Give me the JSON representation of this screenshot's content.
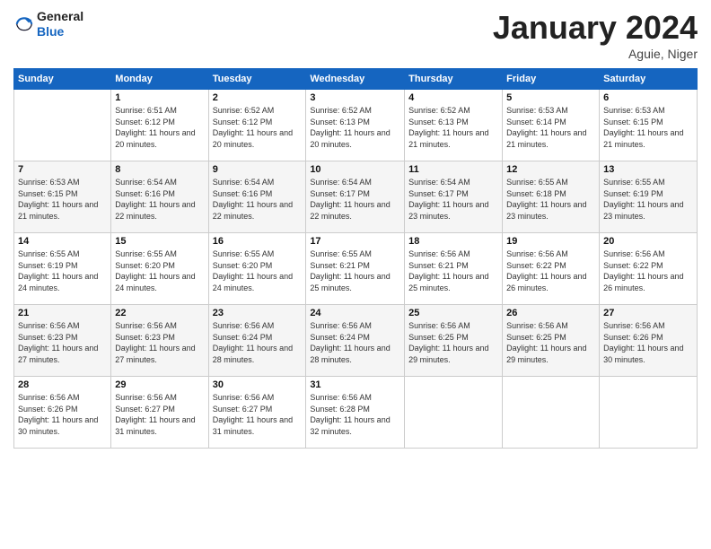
{
  "logo": {
    "line1": "General",
    "line2": "Blue"
  },
  "title": "January 2024",
  "location": "Aguie, Niger",
  "header_days": [
    "Sunday",
    "Monday",
    "Tuesday",
    "Wednesday",
    "Thursday",
    "Friday",
    "Saturday"
  ],
  "weeks": [
    [
      {
        "day": "",
        "sunrise": "",
        "sunset": "",
        "daylight": ""
      },
      {
        "day": "1",
        "sunrise": "Sunrise: 6:51 AM",
        "sunset": "Sunset: 6:12 PM",
        "daylight": "Daylight: 11 hours and 20 minutes."
      },
      {
        "day": "2",
        "sunrise": "Sunrise: 6:52 AM",
        "sunset": "Sunset: 6:12 PM",
        "daylight": "Daylight: 11 hours and 20 minutes."
      },
      {
        "day": "3",
        "sunrise": "Sunrise: 6:52 AM",
        "sunset": "Sunset: 6:13 PM",
        "daylight": "Daylight: 11 hours and 20 minutes."
      },
      {
        "day": "4",
        "sunrise": "Sunrise: 6:52 AM",
        "sunset": "Sunset: 6:13 PM",
        "daylight": "Daylight: 11 hours and 21 minutes."
      },
      {
        "day": "5",
        "sunrise": "Sunrise: 6:53 AM",
        "sunset": "Sunset: 6:14 PM",
        "daylight": "Daylight: 11 hours and 21 minutes."
      },
      {
        "day": "6",
        "sunrise": "Sunrise: 6:53 AM",
        "sunset": "Sunset: 6:15 PM",
        "daylight": "Daylight: 11 hours and 21 minutes."
      }
    ],
    [
      {
        "day": "7",
        "sunrise": "Sunrise: 6:53 AM",
        "sunset": "Sunset: 6:15 PM",
        "daylight": "Daylight: 11 hours and 21 minutes."
      },
      {
        "day": "8",
        "sunrise": "Sunrise: 6:54 AM",
        "sunset": "Sunset: 6:16 PM",
        "daylight": "Daylight: 11 hours and 22 minutes."
      },
      {
        "day": "9",
        "sunrise": "Sunrise: 6:54 AM",
        "sunset": "Sunset: 6:16 PM",
        "daylight": "Daylight: 11 hours and 22 minutes."
      },
      {
        "day": "10",
        "sunrise": "Sunrise: 6:54 AM",
        "sunset": "Sunset: 6:17 PM",
        "daylight": "Daylight: 11 hours and 22 minutes."
      },
      {
        "day": "11",
        "sunrise": "Sunrise: 6:54 AM",
        "sunset": "Sunset: 6:17 PM",
        "daylight": "Daylight: 11 hours and 23 minutes."
      },
      {
        "day": "12",
        "sunrise": "Sunrise: 6:55 AM",
        "sunset": "Sunset: 6:18 PM",
        "daylight": "Daylight: 11 hours and 23 minutes."
      },
      {
        "day": "13",
        "sunrise": "Sunrise: 6:55 AM",
        "sunset": "Sunset: 6:19 PM",
        "daylight": "Daylight: 11 hours and 23 minutes."
      }
    ],
    [
      {
        "day": "14",
        "sunrise": "Sunrise: 6:55 AM",
        "sunset": "Sunset: 6:19 PM",
        "daylight": "Daylight: 11 hours and 24 minutes."
      },
      {
        "day": "15",
        "sunrise": "Sunrise: 6:55 AM",
        "sunset": "Sunset: 6:20 PM",
        "daylight": "Daylight: 11 hours and 24 minutes."
      },
      {
        "day": "16",
        "sunrise": "Sunrise: 6:55 AM",
        "sunset": "Sunset: 6:20 PM",
        "daylight": "Daylight: 11 hours and 24 minutes."
      },
      {
        "day": "17",
        "sunrise": "Sunrise: 6:55 AM",
        "sunset": "Sunset: 6:21 PM",
        "daylight": "Daylight: 11 hours and 25 minutes."
      },
      {
        "day": "18",
        "sunrise": "Sunrise: 6:56 AM",
        "sunset": "Sunset: 6:21 PM",
        "daylight": "Daylight: 11 hours and 25 minutes."
      },
      {
        "day": "19",
        "sunrise": "Sunrise: 6:56 AM",
        "sunset": "Sunset: 6:22 PM",
        "daylight": "Daylight: 11 hours and 26 minutes."
      },
      {
        "day": "20",
        "sunrise": "Sunrise: 6:56 AM",
        "sunset": "Sunset: 6:22 PM",
        "daylight": "Daylight: 11 hours and 26 minutes."
      }
    ],
    [
      {
        "day": "21",
        "sunrise": "Sunrise: 6:56 AM",
        "sunset": "Sunset: 6:23 PM",
        "daylight": "Daylight: 11 hours and 27 minutes."
      },
      {
        "day": "22",
        "sunrise": "Sunrise: 6:56 AM",
        "sunset": "Sunset: 6:23 PM",
        "daylight": "Daylight: 11 hours and 27 minutes."
      },
      {
        "day": "23",
        "sunrise": "Sunrise: 6:56 AM",
        "sunset": "Sunset: 6:24 PM",
        "daylight": "Daylight: 11 hours and 28 minutes."
      },
      {
        "day": "24",
        "sunrise": "Sunrise: 6:56 AM",
        "sunset": "Sunset: 6:24 PM",
        "daylight": "Daylight: 11 hours and 28 minutes."
      },
      {
        "day": "25",
        "sunrise": "Sunrise: 6:56 AM",
        "sunset": "Sunset: 6:25 PM",
        "daylight": "Daylight: 11 hours and 29 minutes."
      },
      {
        "day": "26",
        "sunrise": "Sunrise: 6:56 AM",
        "sunset": "Sunset: 6:25 PM",
        "daylight": "Daylight: 11 hours and 29 minutes."
      },
      {
        "day": "27",
        "sunrise": "Sunrise: 6:56 AM",
        "sunset": "Sunset: 6:26 PM",
        "daylight": "Daylight: 11 hours and 30 minutes."
      }
    ],
    [
      {
        "day": "28",
        "sunrise": "Sunrise: 6:56 AM",
        "sunset": "Sunset: 6:26 PM",
        "daylight": "Daylight: 11 hours and 30 minutes."
      },
      {
        "day": "29",
        "sunrise": "Sunrise: 6:56 AM",
        "sunset": "Sunset: 6:27 PM",
        "daylight": "Daylight: 11 hours and 31 minutes."
      },
      {
        "day": "30",
        "sunrise": "Sunrise: 6:56 AM",
        "sunset": "Sunset: 6:27 PM",
        "daylight": "Daylight: 11 hours and 31 minutes."
      },
      {
        "day": "31",
        "sunrise": "Sunrise: 6:56 AM",
        "sunset": "Sunset: 6:28 PM",
        "daylight": "Daylight: 11 hours and 32 minutes."
      },
      {
        "day": "",
        "sunrise": "",
        "sunset": "",
        "daylight": ""
      },
      {
        "day": "",
        "sunrise": "",
        "sunset": "",
        "daylight": ""
      },
      {
        "day": "",
        "sunrise": "",
        "sunset": "",
        "daylight": ""
      }
    ]
  ]
}
